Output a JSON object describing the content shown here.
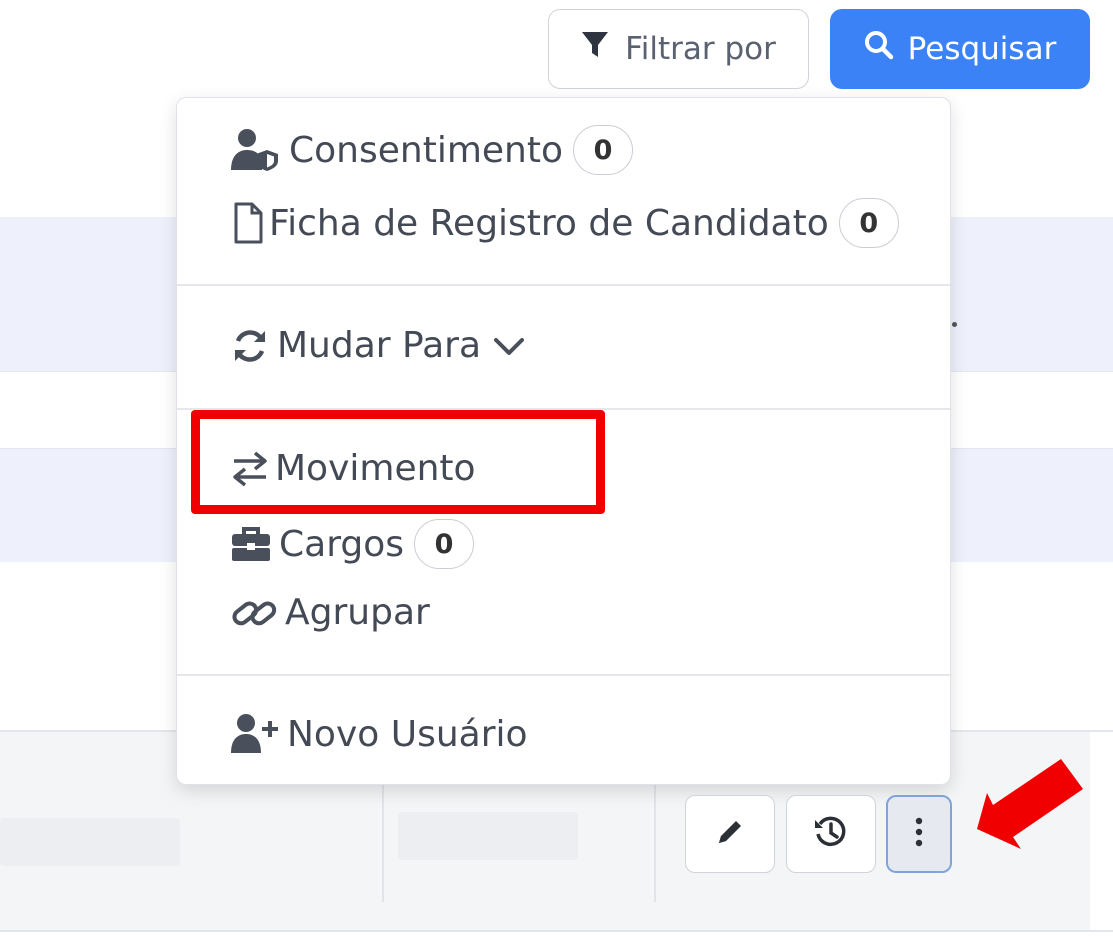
{
  "toolbar": {
    "filter_label": "Filtrar por",
    "search_label": "Pesquisar",
    "accent_color": "#3b82f6"
  },
  "menu": {
    "consent": {
      "label": "Consentimento",
      "count": "0",
      "icon": "user-shield-icon"
    },
    "candidate_form": {
      "label": "Ficha de Registro de Candidato",
      "count": "0",
      "icon": "file-icon"
    },
    "change_to": {
      "label": "Mudar Para",
      "icon": "sync-icon"
    },
    "movement": {
      "label": "Movimento",
      "icon": "exchange-icon"
    },
    "positions": {
      "label": "Cargos",
      "count": "0",
      "icon": "briefcase-icon"
    },
    "group": {
      "label": "Agrupar",
      "icon": "link-icon"
    },
    "new_user": {
      "label": "Novo Usuário",
      "icon": "user-plus-icon"
    }
  },
  "row_actions": {
    "edit": {
      "icon": "pencil-icon"
    },
    "history": {
      "icon": "history-icon"
    },
    "more": {
      "icon": "vertical-ellipsis-icon"
    }
  },
  "annotations": {
    "highlight_color": "#f00000",
    "arrow_color": "#f00000"
  }
}
